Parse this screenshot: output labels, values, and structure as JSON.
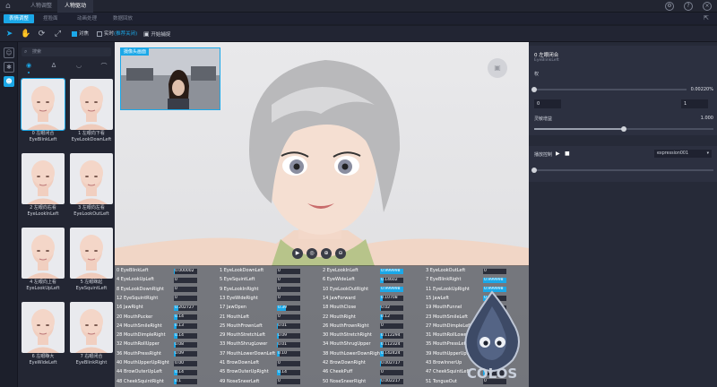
{
  "tabs": [
    "人物调整",
    "人物驱动"
  ],
  "active_tab_index": 1,
  "subtabs": [
    "表情调整",
    "捏脸面",
    "动画处理",
    "数据回放"
  ],
  "toolbar": {
    "checkbox_1": "对焦",
    "checkbox_2": "实时",
    "checkbox_2_suffix": "(推荐关闭)",
    "camera_button": "开始捕捉"
  },
  "search": {
    "placeholder": "搜索"
  },
  "expression_cards": [
    {
      "index": "0",
      "name_cn": "左眼闭合",
      "name_en": "EyeBlinkLeft"
    },
    {
      "index": "1",
      "name_cn": "左眼向下看",
      "name_en": "EyeLookDownLeft"
    },
    {
      "index": "2",
      "name_cn": "左眼向右看",
      "name_en": "EyeLookInLeft"
    },
    {
      "index": "3",
      "name_cn": "左眼向左看",
      "name_en": "EyeLookOutLeft"
    },
    {
      "index": "4",
      "name_cn": "左眼向上看",
      "name_en": "EyeLookUpLeft"
    },
    {
      "index": "5",
      "name_cn": "左眼眯起",
      "name_en": "EyeSquintLeft"
    },
    {
      "index": "6",
      "name_cn": "左眼睁大",
      "name_en": "EyeWideLeft"
    },
    {
      "index": "7",
      "name_cn": "右眼闭合",
      "name_en": "EyeBlinkRight"
    }
  ],
  "pip_tag": "摄像头画面",
  "blendshapes": [
    {
      "label": "0  EyeBlinkLeft",
      "value": "0.000002",
      "level": 0.02
    },
    {
      "label": "1  EyeLookDownLeft",
      "value": "0",
      "level": 0
    },
    {
      "label": "2  EyeLookInLeft",
      "value": "0.999998",
      "level": 1.0
    },
    {
      "label": "3  EyeLookOutLeft",
      "value": "0",
      "level": 0
    },
    {
      "label": "4  EyeLookUpLeft",
      "value": "0",
      "level": 0
    },
    {
      "label": "5  EyeSquintLeft",
      "value": "0",
      "level": 0
    },
    {
      "label": "6  EyeWideLeft",
      "value": "0.14602",
      "level": 0.146
    },
    {
      "label": "7  EyeBlinkRight",
      "value": "0.999998",
      "level": 1.0
    },
    {
      "label": "8  EyeLookDownRight",
      "value": "0",
      "level": 0
    },
    {
      "label": "9  EyeLookInRight",
      "value": "0",
      "level": 0
    },
    {
      "label": "10  EyeLookOutRight",
      "value": "0.999998",
      "level": 1.0
    },
    {
      "label": "11  EyeLookUpRight",
      "value": "0.999998",
      "level": 1.0
    },
    {
      "label": "12  EyeSquintRight",
      "value": "0",
      "level": 0
    },
    {
      "label": "13  EyeWideRight",
      "value": "0",
      "level": 0
    },
    {
      "label": "14  JawForward",
      "value": "0.10708",
      "level": 0.107
    },
    {
      "label": "15  JawLeft",
      "value": "0.37",
      "level": 0.37
    },
    {
      "label": "16  JawRight",
      "value": "0.202727",
      "level": 0.2
    },
    {
      "label": "17  JawOpen",
      "value": "0.39",
      "level": 0.39
    },
    {
      "label": "18  MouthClose",
      "value": "0.02",
      "level": 0.02
    },
    {
      "label": "19  MouthFunnel",
      "value": "0",
      "level": 0
    },
    {
      "label": "20  MouthPucker",
      "value": "0.14",
      "level": 0.14
    },
    {
      "label": "21  MouthLeft",
      "value": "0",
      "level": 0
    },
    {
      "label": "22  MouthRight",
      "value": "0.12",
      "level": 0.12
    },
    {
      "label": "23  MouthSmileLeft",
      "value": "0",
      "level": 0
    },
    {
      "label": "24  MouthSmileRight",
      "value": "0.13",
      "level": 0.13
    },
    {
      "label": "25  MouthFrownLeft",
      "value": "0.01",
      "level": 0.01
    },
    {
      "label": "26  MouthFrownRight",
      "value": "0",
      "level": 0
    },
    {
      "label": "27  MouthDimpleLeft",
      "value": "0.08",
      "level": 0.08
    },
    {
      "label": "28  MouthDimpleRight",
      "value": "0.14",
      "level": 0.14
    },
    {
      "label": "29  MouthStretchLeft",
      "value": "0.09",
      "level": 0.09
    },
    {
      "label": "30  MouthStretchRight",
      "value": "0.112294",
      "level": 0.11
    },
    {
      "label": "31  MouthRollLower",
      "value": "0.04",
      "level": 0.04
    },
    {
      "label": "32  MouthRollUpper",
      "value": "0.08",
      "level": 0.08
    },
    {
      "label": "33  MouthShrugLower",
      "value": "0.01",
      "level": 0.01
    },
    {
      "label": "34  MouthShrugUpper",
      "value": "0.112324",
      "level": 0.11
    },
    {
      "label": "35  MouthPressLeft",
      "value": "0.08",
      "level": 0.08
    },
    {
      "label": "36  MouthPressRight",
      "value": "0.09",
      "level": 0.09
    },
    {
      "label": "37  MouthLowerDownLeft",
      "value": "0.10",
      "level": 0.1
    },
    {
      "label": "38  MouthLowerDownRight",
      "value": "0.142424",
      "level": 0.14
    },
    {
      "label": "39  MouthUpperUpLeft",
      "value": "0.14",
      "level": 0.14
    },
    {
      "label": "40  MouthUpperUpRight",
      "value": "0.00",
      "level": 0.0
    },
    {
      "label": "41  BrowDownLeft",
      "value": "0",
      "level": 0
    },
    {
      "label": "42  BrowDownRight",
      "value": "0.002717",
      "level": 0.03
    },
    {
      "label": "43  BrowInnerUp",
      "value": "0.4",
      "level": 0.4
    },
    {
      "label": "44  BrowOuterUpLeft",
      "value": "0.14",
      "level": 0.14
    },
    {
      "label": "45  BrowOuterUpRight",
      "value": "0.14",
      "level": 0.14
    },
    {
      "label": "46  CheekPuff",
      "value": "0",
      "level": 0
    },
    {
      "label": "47  CheekSquintLeft",
      "value": "0.14",
      "level": 0.14
    },
    {
      "label": "48  CheekSquintRight",
      "value": "0.1",
      "level": 0.1
    },
    {
      "label": "49  NoseSneerLeft",
      "value": "0",
      "level": 0
    },
    {
      "label": "50  NoseSneerRight",
      "value": "0.002217",
      "level": 0.02
    },
    {
      "label": "51  TongueOut",
      "value": "0",
      "level": 0
    }
  ],
  "right_panel": {
    "title": "0  左眼闭合",
    "subtitle": "EyeBlinkLeft",
    "weight_label": "权",
    "weight_value": "0.00220%",
    "weight_level": 0.0,
    "min_value": "0",
    "max_value": "1",
    "intensity_label": "灵敏增益",
    "intensity_value": "1.000",
    "intensity_level": 0.5,
    "playback_label": "播放控制",
    "playback_file": "expression001"
  },
  "logo_text": "COLOS"
}
